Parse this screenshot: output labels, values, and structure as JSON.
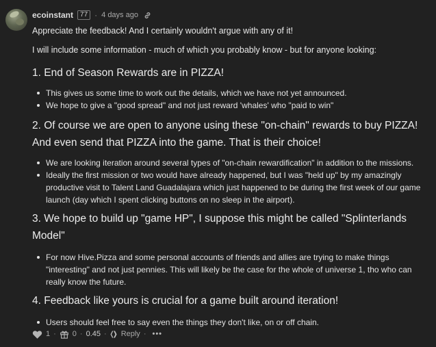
{
  "comment": {
    "author": "ecoinstant",
    "reputation": "77",
    "time": "4 days ago",
    "paragraphs": [
      "Appreciate the feedback! And I certainly wouldn't argue with any of it!",
      "I will include some information - much of which you probably know - but for anyone looking:"
    ],
    "sections": [
      {
        "heading": "1. End of Season Rewards are in PIZZA!",
        "items": [
          "This gives us some time to work out the details, which we have not yet announced.",
          "We hope to give a \"good spread\" and not just reward 'whales' who \"paid to win\""
        ]
      },
      {
        "heading": "2. Of course we are open to anyone using these \"on-chain\" rewards to buy PIZZA! And even send that PIZZA into the game. That is their choice!",
        "items": [
          "We are looking iteration around several types of \"on-chain rewardification\" in addition to the missions.",
          "Ideally the first mission or two would have already happened, but I was \"held up\" by my amazingly productive visit to Talent Land Guadalajara which just happened to be during the first week of our game launch (day which I spent clicking buttons on no sleep in the airport)."
        ]
      },
      {
        "heading": "3. We hope to build up \"game HP\", I suppose this might be called \"Splinterlands Model\"",
        "items": [
          "For now Hive.Pizza and some personal accounts of friends and allies are trying to make things \"interesting\" and not just pennies. This will likely be the case for the whole of universe 1, tho who can really know the future."
        ]
      },
      {
        "heading": "4. Feedback like yours is crucial for a game built around iteration!",
        "items": [
          "Users should feel free to say even the things they don't like, on or off chain."
        ]
      }
    ]
  },
  "footer": {
    "likes": "1",
    "gifts": "0",
    "payout": "0.45",
    "reply_label": "Reply",
    "more_label": "•••"
  },
  "icons": {
    "link": "link-icon",
    "heart": "heart-icon",
    "gift": "gift-icon",
    "hive": "hive-logo-icon",
    "more": "more-options-icon"
  }
}
